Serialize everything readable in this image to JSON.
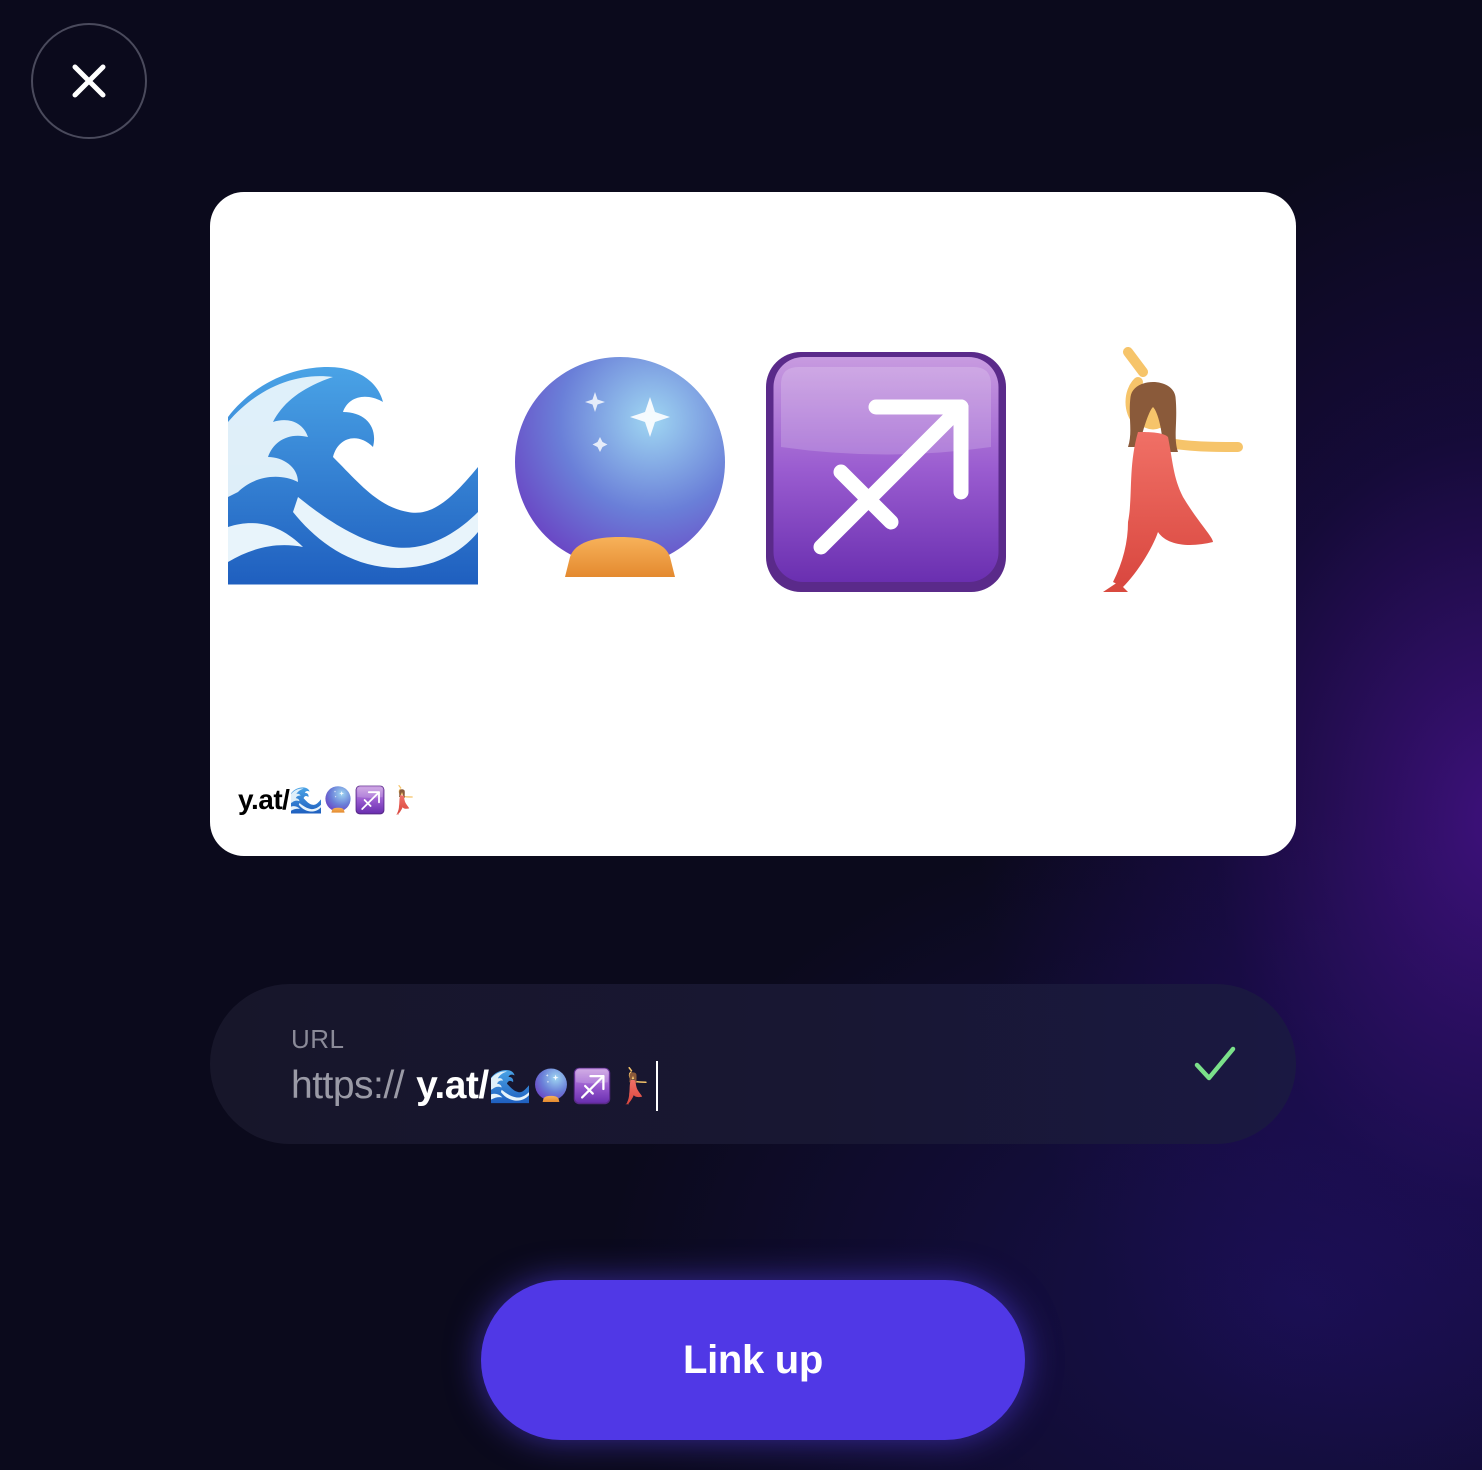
{
  "close_button": {
    "icon": "close-icon"
  },
  "card": {
    "emojis": [
      "water-wave",
      "crystal-ball",
      "sagittarius",
      "woman-dancing"
    ],
    "handle_text": "y.at/"
  },
  "url_field": {
    "label": "URL",
    "prefix": "https://",
    "value_text": "y.at/",
    "emojis": [
      "water-wave",
      "crystal-ball",
      "sagittarius",
      "woman-dancing"
    ],
    "valid_icon": "check-icon"
  },
  "primary_button": {
    "label": "Link up"
  },
  "colors": {
    "background": "#0b0a1c",
    "accent": "#5038e6",
    "check": "#7be08a",
    "card": "#ffffff"
  }
}
